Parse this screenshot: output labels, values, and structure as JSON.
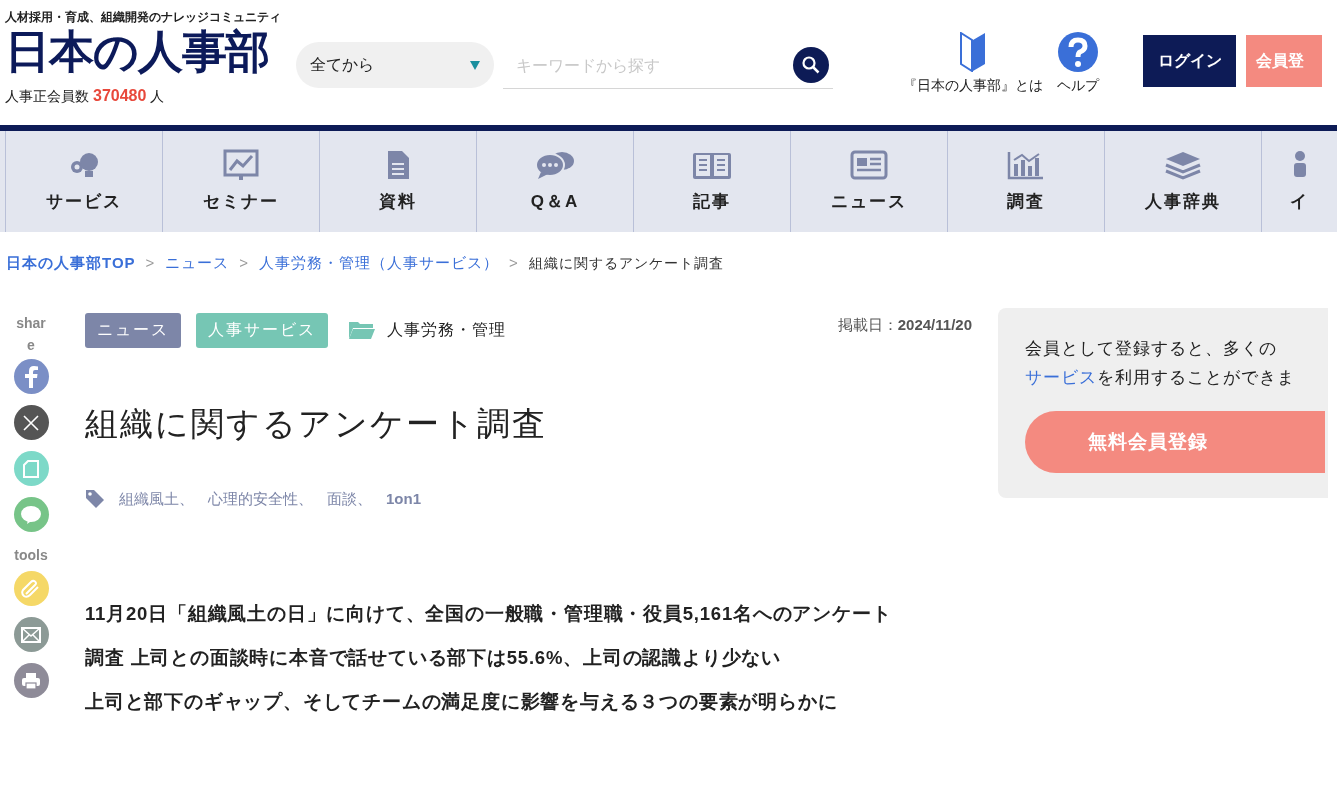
{
  "header": {
    "tagline": "人材採用・育成、組織開発のナレッジコミュニティ",
    "logo": "日本の人事部",
    "member_count": {
      "label": "人事正会員数",
      "count": "370480",
      "unit": "人"
    },
    "search": {
      "category": "全てから",
      "placeholder": "キーワードから探す"
    },
    "links": [
      {
        "label": "『日本の人事部』とは"
      },
      {
        "label": "ヘルプ"
      }
    ],
    "login": "ログイン",
    "register": "会員登"
  },
  "nav": [
    {
      "label": "サービス"
    },
    {
      "label": "セミナー"
    },
    {
      "label": "資料"
    },
    {
      "label": "Q＆A"
    },
    {
      "label": "記事"
    },
    {
      "label": "ニュース"
    },
    {
      "label": "調査"
    },
    {
      "label": "人事辞典"
    },
    {
      "label": "イ"
    }
  ],
  "breadcrumb": [
    {
      "label": "日本の人事部TOP",
      "current": false
    },
    {
      "separator": ">",
      "label": "ニュース",
      "current": false
    },
    {
      "separator": ">",
      "label": "人事労務・管理（人事サービス）",
      "current": false
    },
    {
      "separator": ">",
      "label": "組織に関するアンケート調査",
      "current": true
    }
  ],
  "share": {
    "label": "share",
    "tools_label": "tools"
  },
  "article": {
    "badges": [
      {
        "label": "ニュース",
        "color": "#7d86a8"
      },
      {
        "label": "人事サービス",
        "color": "#76c6b4"
      }
    ],
    "category": "人事労務・管理",
    "date_label": "掲載日：",
    "date": "2024/11/20",
    "title": "組織に関するアンケート調査",
    "tags": [
      {
        "label": "組織風土、",
        "bold": false
      },
      {
        "label": "心理的安全性、",
        "bold": false
      },
      {
        "label": "面談、",
        "bold": false
      },
      {
        "label": "1on1",
        "bold": true
      }
    ],
    "lead": [
      "11月20日「組織風土の日」に向けて、全国の一般職・管理職・役員5,161名へのアンケート",
      "調査 上司との面談時に本音で話せている部下は55.6%、上司の認識より少ない",
      "上司と部下のギャップ、そしてチームの満足度に影響を与える３つの要素が明らかに"
    ]
  },
  "signup_card": {
    "line1": "会員として登録すると、多くの",
    "link": "サービス",
    "line2": "を利用することができま",
    "button": "無料会員登録"
  }
}
